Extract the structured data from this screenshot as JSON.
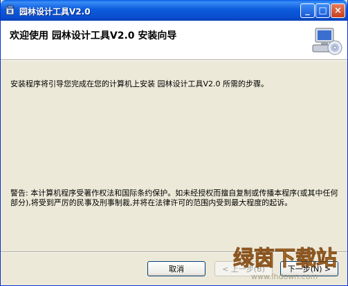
{
  "window": {
    "title": "园林设计工具V2.0",
    "minimize_label": "_",
    "maximize_label": "□",
    "close_label": "×"
  },
  "header": {
    "title": "欢迎使用 园林设计工具V2.0 安装向导"
  },
  "body": {
    "welcome_text": "安装程序将引导您完成在您的计算机上安装 园林设计工具V2.0 所需的步骤。",
    "warning_text": "警告: 本计算机程序受著作权法和国际条约保护。如未经授权而擅自复制或传播本程序(或其中任何部分),将受到严厉的民事及刑事制裁,并将在法律许可的范围内受到最大程度的起诉。"
  },
  "buttons": {
    "cancel": "取消",
    "back": "< 上一步(B)",
    "next": "下一步(N) >"
  },
  "watermark": {
    "text": "绿茵下载站",
    "url": "www.lhdown.com"
  },
  "colors": {
    "titlebar": "#0a4fd0",
    "window_bg": "#ece9d8",
    "header_bg": "#ffffff"
  }
}
